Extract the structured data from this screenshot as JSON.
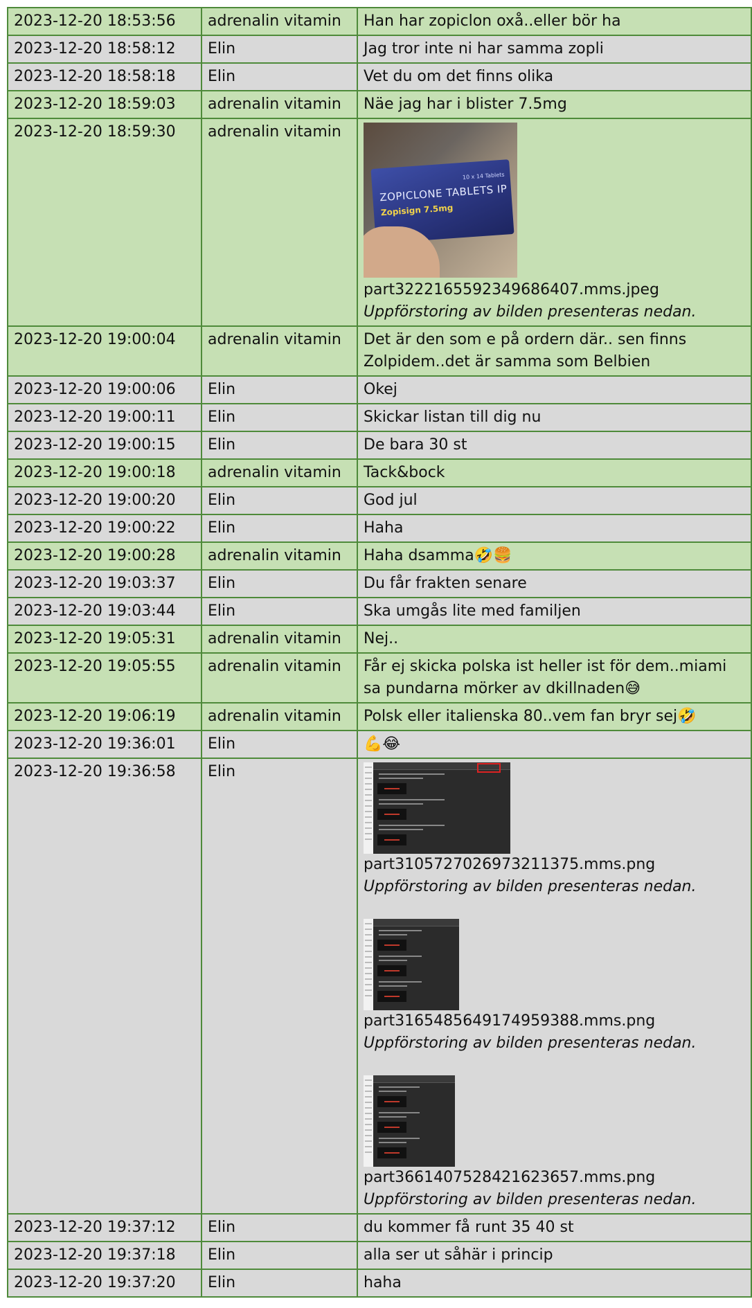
{
  "rows": [
    {
      "ts": "2023-12-20 18:53:56",
      "sender": "adrenalin vitamin",
      "message": "Han har zopiclon oxå..eller bör ha"
    },
    {
      "ts": "2023-12-20 18:58:12",
      "sender": "Elin",
      "message": "Jag tror inte ni har samma zopli"
    },
    {
      "ts": "2023-12-20 18:58:18",
      "sender": "Elin",
      "message": "Vet du om det finns olika"
    },
    {
      "ts": "2023-12-20 18:59:03",
      "sender": "adrenalin vitamin",
      "message": "Näe jag har i blister 7.5mg"
    },
    {
      "ts": "2023-12-20 18:59:30",
      "sender": "adrenalin vitamin",
      "message": "",
      "attachments": [
        {
          "kind": "photo",
          "package_top": "10 x 14 Tablets",
          "package_title": "ZOPICLONE TABLETS IP",
          "package_sub": "Zopisign 7.5mg",
          "filename": "part3222165592349686407.mms.jpeg",
          "caption": "Uppförstoring av bilden presenteras nedan."
        }
      ]
    },
    {
      "ts": "2023-12-20 19:00:04",
      "sender": "adrenalin vitamin",
      "message": "Det är den som e på ordern där.. sen finns Zolpidem..det är samma som Belbien"
    },
    {
      "ts": "2023-12-20 19:00:06",
      "sender": "Elin",
      "message": "Okej"
    },
    {
      "ts": "2023-12-20 19:00:11",
      "sender": "Elin",
      "message": "Skickar listan till dig nu"
    },
    {
      "ts": "2023-12-20 19:00:15",
      "sender": "Elin",
      "message": "De bara 30 st"
    },
    {
      "ts": "2023-12-20 19:00:18",
      "sender": "adrenalin vitamin",
      "message": "Tack&bock"
    },
    {
      "ts": "2023-12-20 19:00:20",
      "sender": "Elin",
      "message": "God jul"
    },
    {
      "ts": "2023-12-20 19:00:22",
      "sender": "Elin",
      "message": "Haha"
    },
    {
      "ts": "2023-12-20 19:00:28",
      "sender": "adrenalin vitamin",
      "message": "Haha dsamma🤣🍔"
    },
    {
      "ts": "2023-12-20 19:03:37",
      "sender": "Elin",
      "message": "Du får frakten senare"
    },
    {
      "ts": "2023-12-20 19:03:44",
      "sender": "Elin",
      "message": "Ska umgås lite med familjen"
    },
    {
      "ts": "2023-12-20 19:05:31",
      "sender": "adrenalin vitamin",
      "message": "Nej.."
    },
    {
      "ts": "2023-12-20 19:05:55",
      "sender": "adrenalin vitamin",
      "message": "Får ej skicka polska ist heller ist för dem..miami sa pundarna mörker av dkillnaden😅"
    },
    {
      "ts": "2023-12-20 19:06:19",
      "sender": "adrenalin vitamin",
      "message": "Polsk eller italienska 80..vem fan bryr sej🤣"
    },
    {
      "ts": "2023-12-20 19:36:01",
      "sender": "Elin",
      "message": "💪😂"
    },
    {
      "ts": "2023-12-20 19:36:58",
      "sender": "Elin",
      "message": "",
      "attachments": [
        {
          "kind": "screenshot",
          "filename": "part3105727026973211375.mms.png",
          "caption": "Uppförstoring av bilden presenteras nedan."
        },
        {
          "kind": "screenshot",
          "filename": "part3165485649174959388.mms.png",
          "caption": "Uppförstoring av bilden presenteras nedan."
        },
        {
          "kind": "screenshot",
          "filename": "part3661407528421623657.mms.png",
          "caption": "Uppförstoring av bilden presenteras nedan."
        }
      ]
    },
    {
      "ts": "2023-12-20 19:37:12",
      "sender": "Elin",
      "message": "du kommer få runt 35 40 st"
    },
    {
      "ts": "2023-12-20 19:37:18",
      "sender": "Elin",
      "message": "alla ser ut såhär i princip"
    },
    {
      "ts": "2023-12-20 19:37:20",
      "sender": "Elin",
      "message": "haha"
    }
  ],
  "colors": {
    "sender_a_row": "#c6e0b4",
    "sender_b_row": "#d9d9d9",
    "border": "#4e8a3a"
  }
}
